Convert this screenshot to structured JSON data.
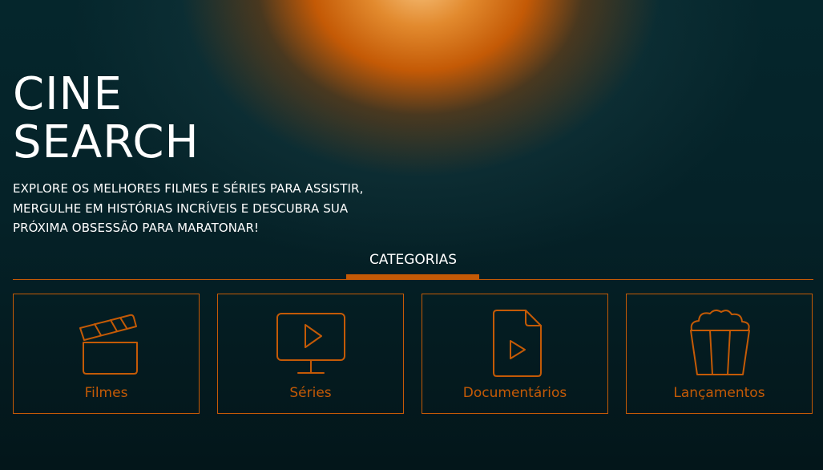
{
  "hero": {
    "title_line1": "CINE",
    "title_line2": "SEARCH",
    "subtitle": "EXPLORE OS MELHORES FILMES E SÉRIES PARA ASSISTIR, MERGULHE EM HISTÓRIAS INCRÍVEIS E DESCUBRA SUA PRÓXIMA OBSESSÃO PARA MARATONAR!"
  },
  "categories": {
    "heading": "CATEGORIAS",
    "items": [
      {
        "label": "Filmes",
        "icon": "clapperboard-icon"
      },
      {
        "label": "Séries",
        "icon": "tv-play-icon"
      },
      {
        "label": "Documentários",
        "icon": "video-file-icon"
      },
      {
        "label": "Lançamentos",
        "icon": "popcorn-icon"
      }
    ]
  },
  "colors": {
    "accent": "#c45a06",
    "background": "#05262c",
    "text": "#ffffff"
  }
}
